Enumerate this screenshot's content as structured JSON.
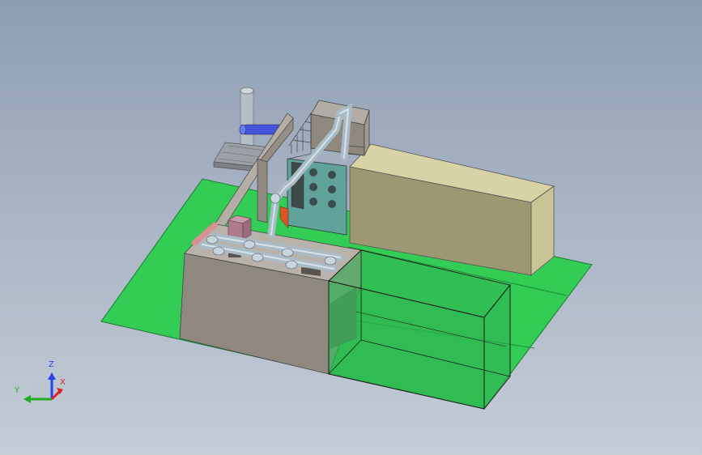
{
  "viewport": {
    "background_top": "#8d9db2",
    "background_bottom": "#c4ccd6",
    "model": {
      "ground_color": "#33cc55",
      "building_color": "#8f887e",
      "tank_color": "#c9c494",
      "pipe_color": "#a9bcc6",
      "panel_color": "#5fa39b",
      "accent_red": "#cc4444",
      "accent_blue": "#4455dd",
      "accent_pink": "#b07a8e"
    }
  },
  "triad": {
    "z_label": "Z",
    "x_label": "X",
    "y_label": "Y",
    "z_color": "#2244ee",
    "x_color": "#dd2222",
    "y_color": "#22aa22"
  }
}
